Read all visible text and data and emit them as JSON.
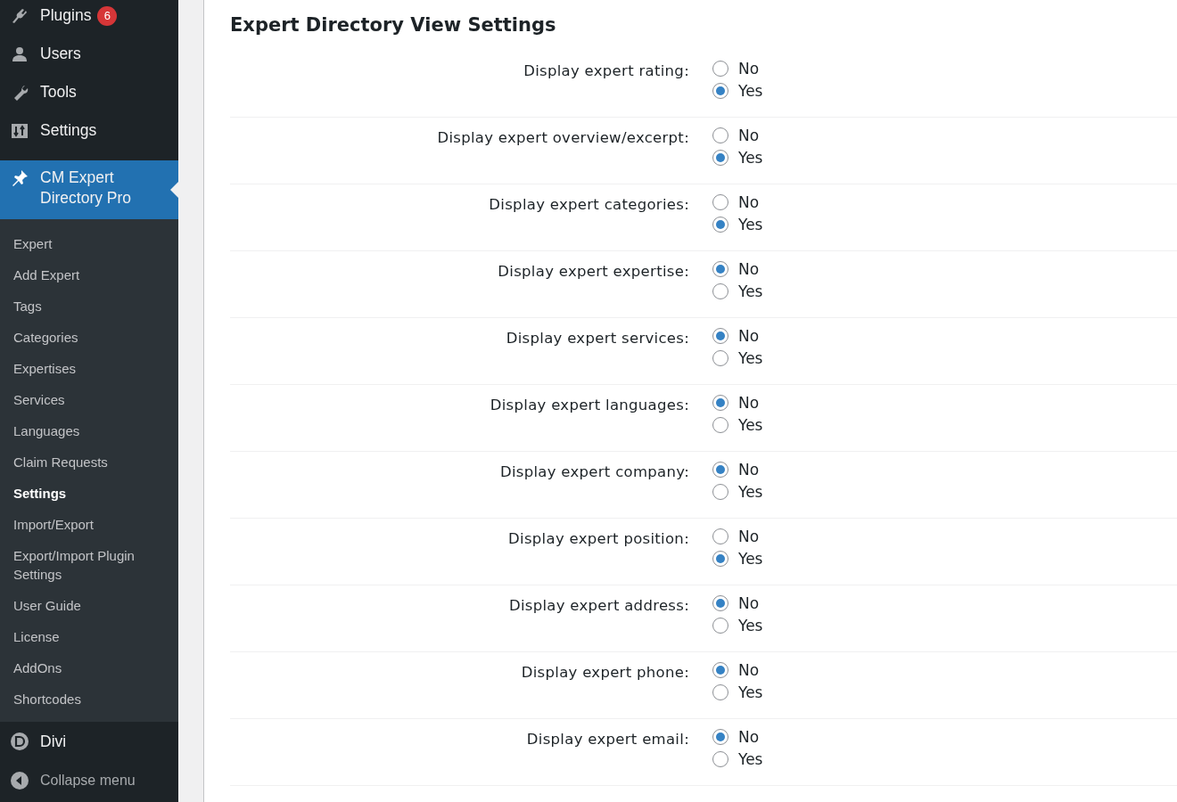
{
  "sidebar": {
    "menu": [
      {
        "label": "Plugins",
        "badge": "6",
        "selected": false
      },
      {
        "label": "Users",
        "selected": false
      },
      {
        "label": "Tools",
        "selected": false
      },
      {
        "label": "Settings",
        "selected": false
      },
      {
        "label": "CM Expert Directory Pro",
        "selected": true
      }
    ],
    "submenu": [
      {
        "label": "Expert",
        "selected": false
      },
      {
        "label": "Add Expert",
        "selected": false
      },
      {
        "label": "Tags",
        "selected": false
      },
      {
        "label": "Categories",
        "selected": false
      },
      {
        "label": "Expertises",
        "selected": false
      },
      {
        "label": "Services",
        "selected": false
      },
      {
        "label": "Languages",
        "selected": false
      },
      {
        "label": "Claim Requests",
        "selected": false
      },
      {
        "label": "Settings",
        "selected": true
      },
      {
        "label": "Import/Export",
        "selected": false
      },
      {
        "label": "Export/Import Plugin Settings",
        "selected": false
      },
      {
        "label": "User Guide",
        "selected": false
      },
      {
        "label": "License",
        "selected": false
      },
      {
        "label": "AddOns",
        "selected": false
      },
      {
        "label": "Shortcodes",
        "selected": false
      }
    ],
    "bottom_menu": [
      {
        "label": "Divi"
      },
      {
        "label": "Collapse menu"
      }
    ]
  },
  "section_title": "Expert Directory View Settings",
  "settings": [
    {
      "label": "Display expert rating:",
      "options": [
        {
          "label": "No",
          "selected": false
        },
        {
          "label": "Yes",
          "selected": true
        }
      ]
    },
    {
      "label": "Display expert overview/excerpt:",
      "options": [
        {
          "label": "No",
          "selected": false
        },
        {
          "label": "Yes",
          "selected": true
        }
      ]
    },
    {
      "label": "Display expert categories:",
      "options": [
        {
          "label": "No",
          "selected": false
        },
        {
          "label": "Yes",
          "selected": true
        }
      ]
    },
    {
      "label": "Display expert expertise:",
      "options": [
        {
          "label": "No",
          "selected": true
        },
        {
          "label": "Yes",
          "selected": false
        }
      ]
    },
    {
      "label": "Display expert services:",
      "options": [
        {
          "label": "No",
          "selected": true
        },
        {
          "label": "Yes",
          "selected": false
        }
      ]
    },
    {
      "label": "Display expert languages:",
      "options": [
        {
          "label": "No",
          "selected": true
        },
        {
          "label": "Yes",
          "selected": false
        }
      ]
    },
    {
      "label": "Display expert company:",
      "options": [
        {
          "label": "No",
          "selected": true
        },
        {
          "label": "Yes",
          "selected": false
        }
      ]
    },
    {
      "label": "Display expert position:",
      "options": [
        {
          "label": "No",
          "selected": false
        },
        {
          "label": "Yes",
          "selected": true
        }
      ]
    },
    {
      "label": "Display expert address:",
      "options": [
        {
          "label": "No",
          "selected": true
        },
        {
          "label": "Yes",
          "selected": false
        }
      ]
    },
    {
      "label": "Display expert phone:",
      "options": [
        {
          "label": "No",
          "selected": true
        },
        {
          "label": "Yes",
          "selected": false
        }
      ]
    },
    {
      "label": "Display expert email:",
      "options": [
        {
          "label": "No",
          "selected": true
        },
        {
          "label": "Yes",
          "selected": false
        }
      ]
    }
  ]
}
